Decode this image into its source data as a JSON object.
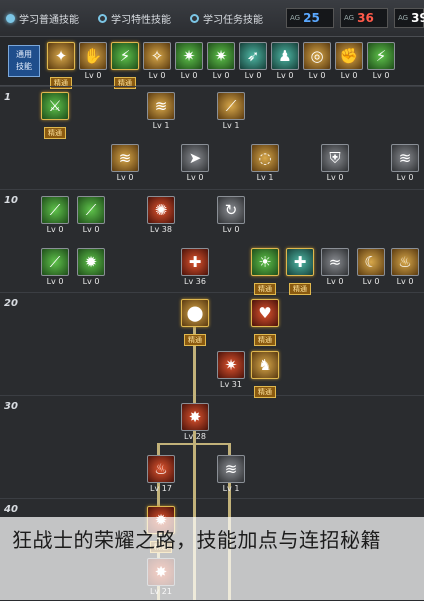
{
  "tabs": [
    {
      "label": "学习普通技能",
      "active": true
    },
    {
      "label": "学习特性技能",
      "active": false
    },
    {
      "label": "学习任务技能",
      "active": false
    }
  ],
  "sp": [
    {
      "label": "AG",
      "value": "25",
      "color": "#5aa8ff"
    },
    {
      "label": "AG",
      "value": "36",
      "color": "#ff5a4a"
    },
    {
      "label": "AG",
      "value": "39",
      "color": "#ffffff"
    }
  ],
  "shortcut": {
    "label": "通用\n技能",
    "skills": [
      {
        "icon": "kick-icon",
        "lv": "精通",
        "color": "c-gold"
      },
      {
        "icon": "hand-icon",
        "lv": "Lv 0",
        "color": "c-gold"
      },
      {
        "icon": "runner-icon",
        "lv": "精通",
        "color": "c-green"
      },
      {
        "icon": "wings-icon",
        "lv": "Lv 0",
        "color": "c-gold"
      },
      {
        "icon": "star-icon",
        "lv": "Lv 0",
        "color": "c-green"
      },
      {
        "icon": "star-icon",
        "lv": "Lv 0",
        "color": "c-green"
      },
      {
        "icon": "leap-icon",
        "lv": "Lv 0",
        "color": "c-teal"
      },
      {
        "icon": "figure-icon",
        "lv": "Lv 0",
        "color": "c-teal"
      },
      {
        "icon": "target-icon",
        "lv": "Lv 0",
        "color": "c-gold"
      },
      {
        "icon": "muscle-icon",
        "lv": "Lv 0",
        "color": "c-gold"
      },
      {
        "icon": "runner-icon",
        "lv": "Lv 0",
        "color": "c-green"
      }
    ]
  },
  "levels": [
    "1",
    "10",
    "20",
    "30",
    "40"
  ],
  "tree": [
    {
      "icon": "sword-icon",
      "lv": "精通",
      "color": "c-green",
      "badge": true
    },
    {
      "icon": "claw-icon",
      "lv": "Lv 1",
      "color": "c-gold"
    },
    {
      "icon": "slash-icon",
      "lv": "Lv 1",
      "color": "c-gold"
    },
    {
      "icon": "claw-icon",
      "lv": "Lv 0",
      "color": "c-gold"
    },
    {
      "icon": "arrow-icon",
      "lv": "Lv 0",
      "color": "c-gray"
    },
    {
      "icon": "swirl-icon",
      "lv": "Lv 1",
      "color": "c-gold"
    },
    {
      "icon": "shield-icon",
      "lv": "Lv 0",
      "color": "c-gray"
    },
    {
      "icon": "claw-icon",
      "lv": "Lv 0",
      "color": "c-gray"
    },
    {
      "icon": "blade-icon",
      "lv": "Lv 0",
      "color": "c-green"
    },
    {
      "icon": "blade-icon",
      "lv": "Lv 0",
      "color": "c-green"
    },
    {
      "icon": "fire-icon",
      "lv": "Lv 38",
      "color": "c-red"
    },
    {
      "icon": "whirl-icon",
      "lv": "Lv 0",
      "color": "c-gray"
    },
    {
      "icon": "blade-icon",
      "lv": "Lv 0",
      "color": "c-green"
    },
    {
      "icon": "burst-icon",
      "lv": "Lv 0",
      "color": "c-green"
    },
    {
      "icon": "cross-icon",
      "lv": "Lv 36",
      "color": "c-red"
    },
    {
      "icon": "rage-icon",
      "lv": "精通",
      "color": "c-green",
      "badge": true
    },
    {
      "icon": "cross-icon",
      "lv": "精通",
      "color": "c-teal",
      "badge": true
    },
    {
      "icon": "wave-icon",
      "lv": "Lv 0",
      "color": "c-gray"
    },
    {
      "icon": "crescent-icon",
      "lv": "Lv 0",
      "color": "c-gold"
    },
    {
      "icon": "flame-icon",
      "lv": "Lv 0",
      "color": "c-gold"
    },
    {
      "icon": "orb-icon",
      "lv": "精通",
      "color": "c-gold",
      "badge": true
    },
    {
      "icon": "heart-icon",
      "lv": "精通",
      "color": "c-red",
      "badge": true
    },
    {
      "icon": "strike-icon",
      "lv": "Lv 31",
      "color": "c-red"
    },
    {
      "icon": "demon-icon",
      "lv": "精通",
      "color": "c-gold",
      "badge": true
    },
    {
      "icon": "explosion-icon",
      "lv": "Lv 28",
      "color": "c-red"
    },
    {
      "icon": "flame-icon",
      "lv": "Lv 17",
      "color": "c-red"
    },
    {
      "icon": "claw-icon",
      "lv": "Lv 1",
      "color": "c-gray"
    },
    {
      "icon": "bloodlust-icon",
      "lv": "精通",
      "color": "c-red",
      "badge": true
    },
    {
      "icon": "explosion-icon",
      "lv": "Lv 21",
      "color": "c-red"
    }
  ],
  "caption": "狂战士的荣耀之路，技能加点与连招秘籍"
}
